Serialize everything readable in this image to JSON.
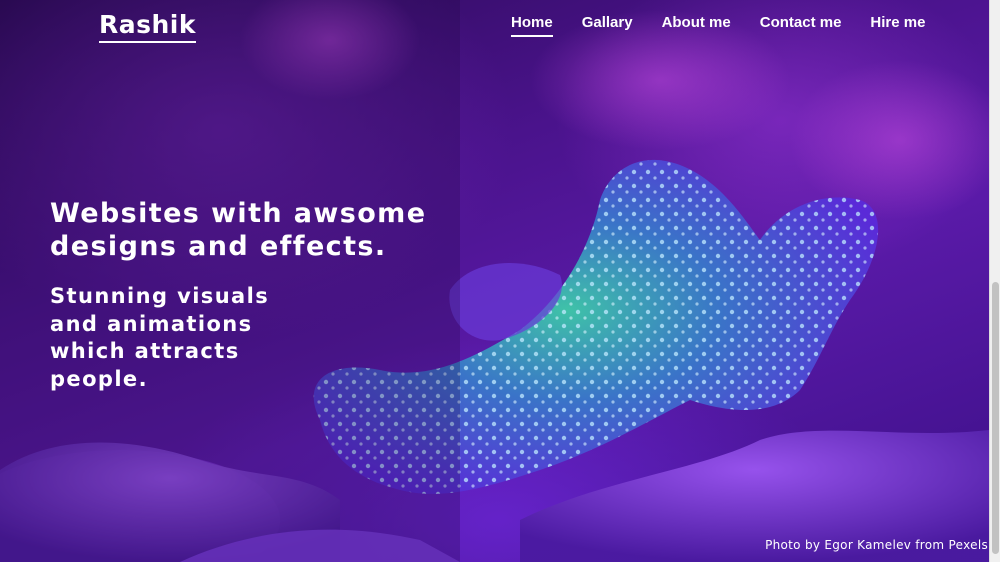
{
  "header": {
    "logo": "Rashik",
    "nav": [
      {
        "label": "Home",
        "active": true
      },
      {
        "label": "Gallary",
        "active": false
      },
      {
        "label": "About me",
        "active": false
      },
      {
        "label": "Contact me",
        "active": false
      },
      {
        "label": "Hire me",
        "active": false
      }
    ]
  },
  "hero": {
    "headline": "Websites with awsome designs and effects.",
    "subline": "Stunning visuals and animations which attracts people.",
    "photo_credit": "Photo by Egor Kamelev from Pexels"
  },
  "colors": {
    "background_purple": "#4a138c",
    "coral_teal": "#2fb5a8",
    "text": "#ffffff"
  }
}
